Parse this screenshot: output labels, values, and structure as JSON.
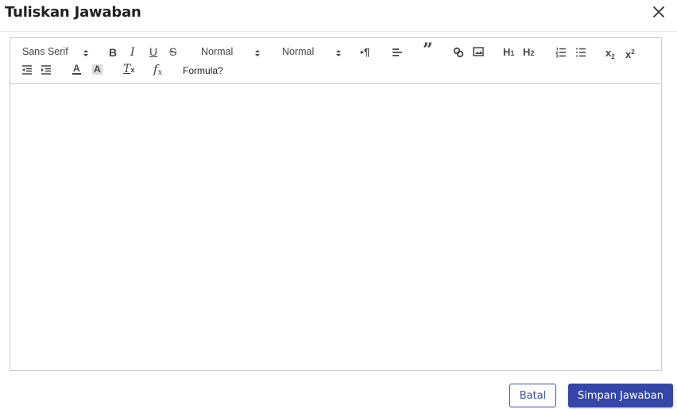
{
  "dialog": {
    "title": "Tuliskan Jawaban",
    "close_icon": "close-icon"
  },
  "toolbar": {
    "font_picker": "Sans Serif",
    "size_picker": "Normal",
    "header_picker": "Normal",
    "formula_label": "Formula?",
    "icons": {
      "bold": "B",
      "italic": "I",
      "underline": "U",
      "strike": "S",
      "h1": "H",
      "h1_sub": "1",
      "h2": "H",
      "h2_sub": "2",
      "clean": "T",
      "clean_sub": "x",
      "formula": "f",
      "formula_sub": "x",
      "quote": "”",
      "color": "A",
      "background": "A",
      "direction": "¶"
    }
  },
  "editor": {
    "content": ""
  },
  "footer": {
    "cancel_label": "Batal",
    "save_label": "Simpan Jawaban"
  },
  "colors": {
    "primary": "#3446a8",
    "border": "#cccccc"
  }
}
